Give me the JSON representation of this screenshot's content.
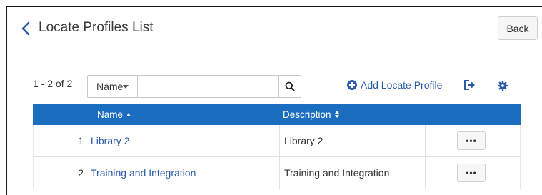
{
  "header": {
    "title": "Locate Profiles List",
    "back_label": "Back"
  },
  "toolbar": {
    "count": "1 - 2 of 2",
    "search_field": "Name",
    "search_value": "",
    "add_label": "Add Locate Profile"
  },
  "table": {
    "columns": [
      "Name",
      "Description"
    ],
    "rows": [
      {
        "num": "1",
        "name": "Library 2",
        "description": "Library 2"
      },
      {
        "num": "2",
        "name": "Training and Integration",
        "description": "Training and Integration"
      }
    ],
    "row_action_label": "•••"
  },
  "colors": {
    "accent": "#1b6dbf",
    "link": "#2a5aa8"
  }
}
